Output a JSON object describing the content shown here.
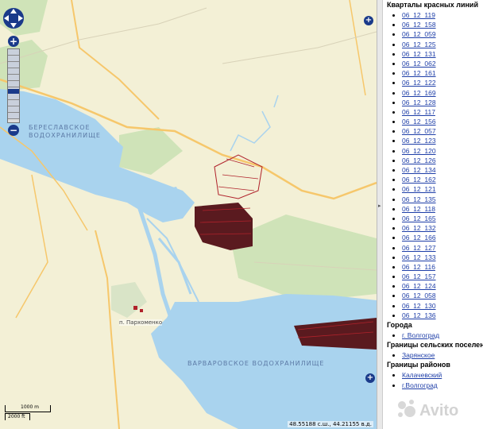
{
  "map": {
    "water_labels": [
      "БЕРЕСЛАВСКОЕ",
      "ВОДОХРАНИЛИЩЕ",
      "ВАРВАРОВСКОЕ ВОДОХРАНИЛИЩЕ"
    ],
    "place_label": "п. Пархоменко",
    "coordinates": "48.55188 с.ш., 44.21155 в.д.",
    "scale": {
      "metric": "1000 m",
      "imperial": "2000 ft"
    },
    "colors": {
      "land": "#f3f0d6",
      "water": "#a9d3ee",
      "green": "#cfe3b8",
      "road": "#f6c76b",
      "parcel": "#b0222b",
      "parcel_dark": "#5a1a1f"
    }
  },
  "panel": {
    "kvartaly_title": "Кварталы красных линий",
    "kvartaly": [
      "06_12_119",
      "06_12_158",
      "06_12_059",
      "06_12_125",
      "06_12_131",
      "06_12_062",
      "06_12_161",
      "06_12_122",
      "06_12_169",
      "06_12_128",
      "06_12_117",
      "06_12_156",
      "06_12_057",
      "06_12_123",
      "06_12_120",
      "06_12_126",
      "06_12_134",
      "06_12_162",
      "06_12_121",
      "06_12_135",
      "06_12_118",
      "06_12_165",
      "06_12_132",
      "06_12_166",
      "06_12_127",
      "06_12_133",
      "06_12_116",
      "06_12_157",
      "06_12_124",
      "06_12_058",
      "06_12_130",
      "06_12_136"
    ],
    "goroda_title": "Города",
    "goroda": [
      "г. Волгоград"
    ],
    "sel_title": "Границы сельских поселени",
    "sel": [
      "Зарянское"
    ],
    "rayon_title": "Границы районов",
    "rayon": [
      "Калачевский",
      "г.Волгоград"
    ]
  },
  "watermark": "Avito"
}
